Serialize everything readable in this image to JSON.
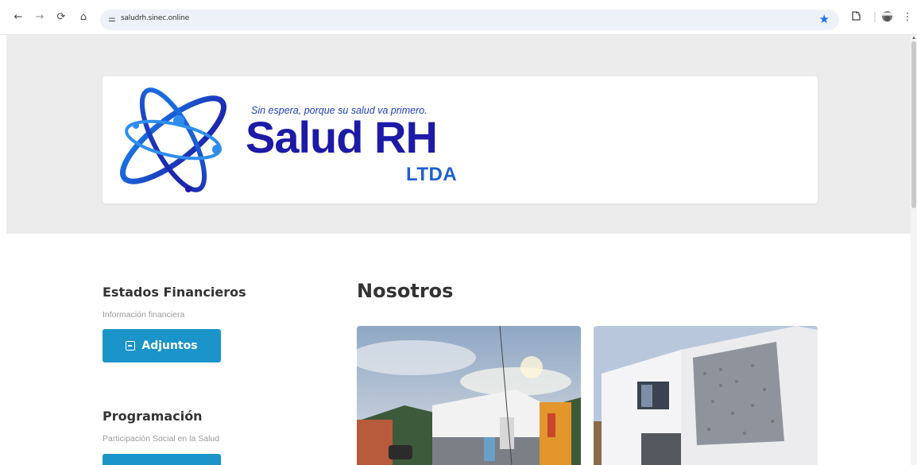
{
  "browser": {
    "url": "saludrh.sinec.online",
    "nav": {
      "back": "←",
      "forward": "→",
      "reload": "⟳",
      "home": "⌂"
    },
    "site_info_icon": "tune-icon",
    "bookmark_icon": "star-icon",
    "extensions_icon": "puzzle-icon",
    "menu_icon": "kebab-icon"
  },
  "logo": {
    "tagline": "Sin espera, porque su salud va primero.",
    "name": "Salud RH",
    "suffix": "LTDA",
    "colors": {
      "dark": "#1d1aa8",
      "light": "#1d5fd6"
    }
  },
  "sidebar": {
    "sections": [
      {
        "title": "Estados Financieros",
        "subtitle": "Información financiera",
        "button": "Adjuntos"
      },
      {
        "title": "Programación",
        "subtitle": "Participación Social en la Salud",
        "button": ""
      }
    ]
  },
  "main": {
    "title": "Nosotros"
  },
  "colors": {
    "accent": "#1a94c9",
    "hero_bg": "#ececec"
  }
}
